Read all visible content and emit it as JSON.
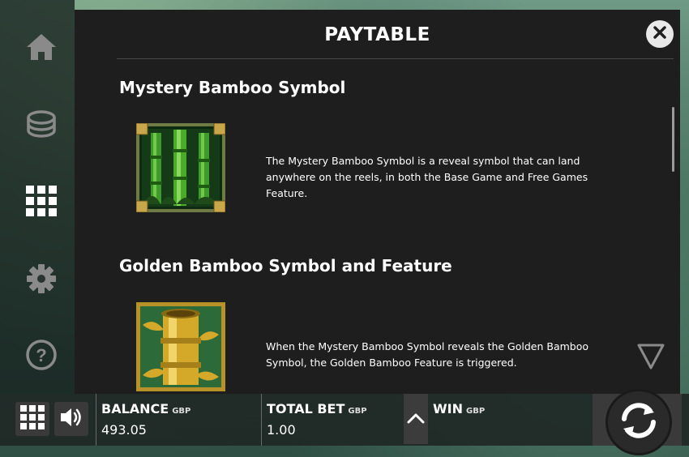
{
  "paytable": {
    "title": "PAYTABLE",
    "sections": [
      {
        "title": "Mystery Bamboo Symbol",
        "symbol_icon": "green-bamboo-symbol",
        "description": "The Mystery Bamboo Symbol is a reveal symbol that can land anywhere on the reels, in both the Base Game and Free Games Feature."
      },
      {
        "title": "Golden Bamboo Symbol and Feature",
        "symbol_icon": "golden-bamboo-symbol",
        "description": "When the Mystery Bamboo Symbol reveals the Golden Bamboo Symbol, the Golden Bamboo Feature is triggered."
      }
    ]
  },
  "side_menu": {
    "icons": [
      "home-icon",
      "coins-icon",
      "grid-icon",
      "gear-icon",
      "help-icon"
    ]
  },
  "footer": {
    "balance": {
      "label": "BALANCE",
      "currency": "GBP",
      "value": "493.05"
    },
    "total_bet": {
      "label": "TOTAL BET",
      "currency": "GBP",
      "value": "1.00"
    },
    "win": {
      "label": "WIN",
      "currency": "GBP",
      "value": ""
    }
  },
  "colors": {
    "panel": "#1e1e1e",
    "text": "#ffffff",
    "icon_gray": "#8a8a8a",
    "gold": "#d4a829",
    "bamboo_green": "#4caa2a"
  }
}
